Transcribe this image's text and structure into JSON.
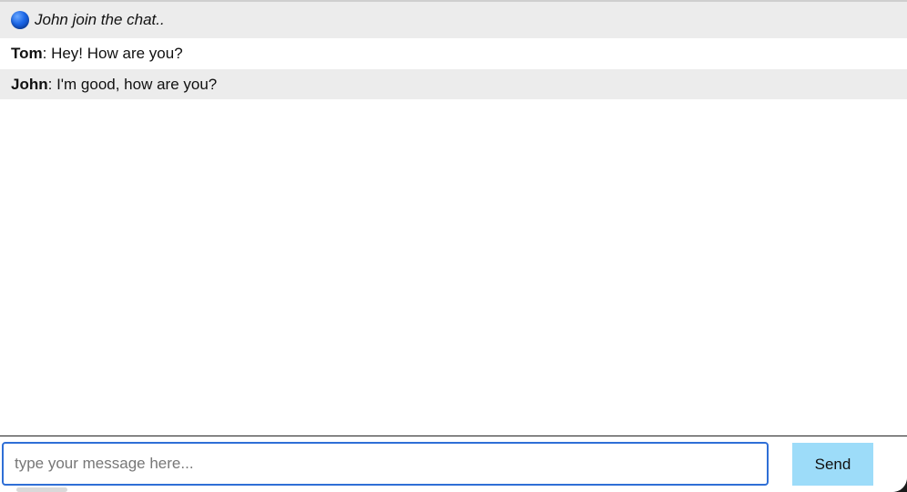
{
  "chat": {
    "join_notice": "John join the chat..",
    "join_icon": "globe-icon",
    "messages": [
      {
        "sender": "Tom",
        "separator": ": ",
        "text": "Hey! How are you?"
      },
      {
        "sender": "John",
        "separator": ": ",
        "text": "I'm good, how are you?"
      }
    ]
  },
  "composer": {
    "placeholder": "type your message here...",
    "value": "",
    "send_label": "Send"
  },
  "colors": {
    "row_alt": "#ececec",
    "send_button": "#9ddcf9",
    "input_focus_border": "#2f6fd6"
  }
}
